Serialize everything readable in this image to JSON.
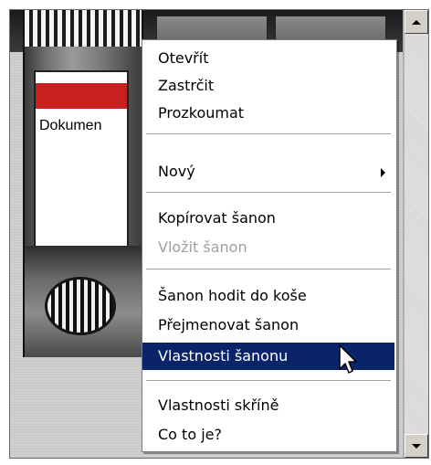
{
  "binder": {
    "label": "Dokumen"
  },
  "menu": {
    "items": [
      {
        "label": "Otevřít"
      },
      {
        "label": "Zastrčit"
      },
      {
        "label": "Prozkoumat"
      },
      {
        "label": "Nový"
      },
      {
        "label": "Kopírovat šanon"
      },
      {
        "label": "Vložit šanon"
      },
      {
        "label": "Šanon hodit do koše"
      },
      {
        "label": "Přejmenovat šanon"
      },
      {
        "label": "Vlastnosti šanonu"
      },
      {
        "label": "Vlastnosti skříně"
      },
      {
        "label": "Co to je?"
      }
    ]
  },
  "colors": {
    "highlight": "#0a246a",
    "binder_band": "#c8201e"
  },
  "icons": {
    "submenu": "chevron-right-icon",
    "cursor": "mouse-pointer-icon",
    "scroll_up": "arrow-up-icon",
    "scroll_down": "arrow-down-icon"
  }
}
